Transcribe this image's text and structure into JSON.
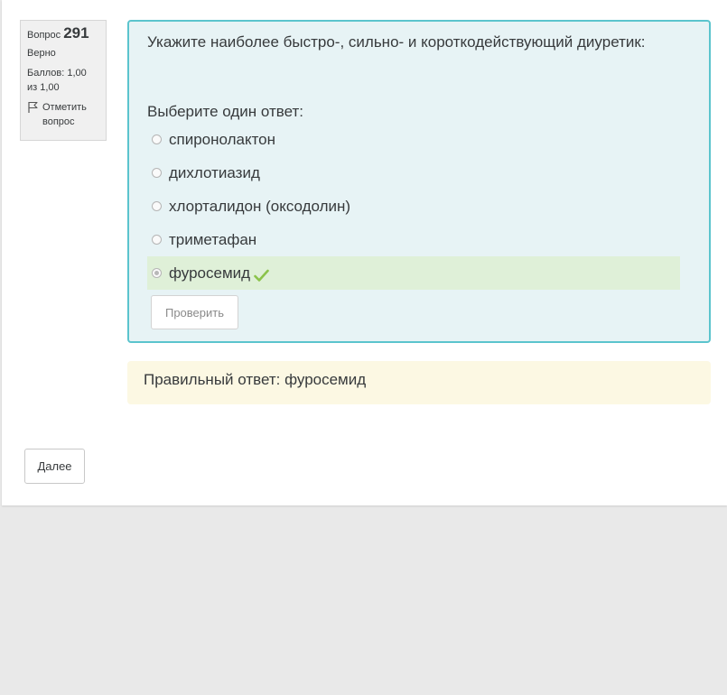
{
  "info": {
    "question_label": "Вопрос",
    "question_number": "291",
    "state": "Верно",
    "grade": "Баллов: 1,00 из 1,00",
    "flag_label": "Отметить вопрос"
  },
  "question": {
    "text": "Укажите наиболее быстро-, сильно- и короткодействующий диуретик:",
    "prompt": "Выберите один ответ:",
    "answers": [
      {
        "label": "спиронолактон",
        "selected": false,
        "correct": false
      },
      {
        "label": "дихлотиазид",
        "selected": false,
        "correct": false
      },
      {
        "label": "хлорталидон (оксодолин)",
        "selected": false,
        "correct": false
      },
      {
        "label": "триметафан",
        "selected": false,
        "correct": false
      },
      {
        "label": "фуросемид",
        "selected": true,
        "correct": true
      }
    ],
    "check_label": "Проверить"
  },
  "feedback": {
    "right_answer": "Правильный ответ: фуросемид"
  },
  "navigation": {
    "next_label": "Далее"
  },
  "colors": {
    "formulation_border": "#5bc4cd",
    "formulation_bg": "#e7f3f5",
    "correct_bg": "#dff0d8",
    "check_mark": "#8bc34a",
    "feedback_bg": "#fcf8e3"
  },
  "icons": {
    "flag": "flag-icon",
    "correct": "check-mark-icon"
  }
}
